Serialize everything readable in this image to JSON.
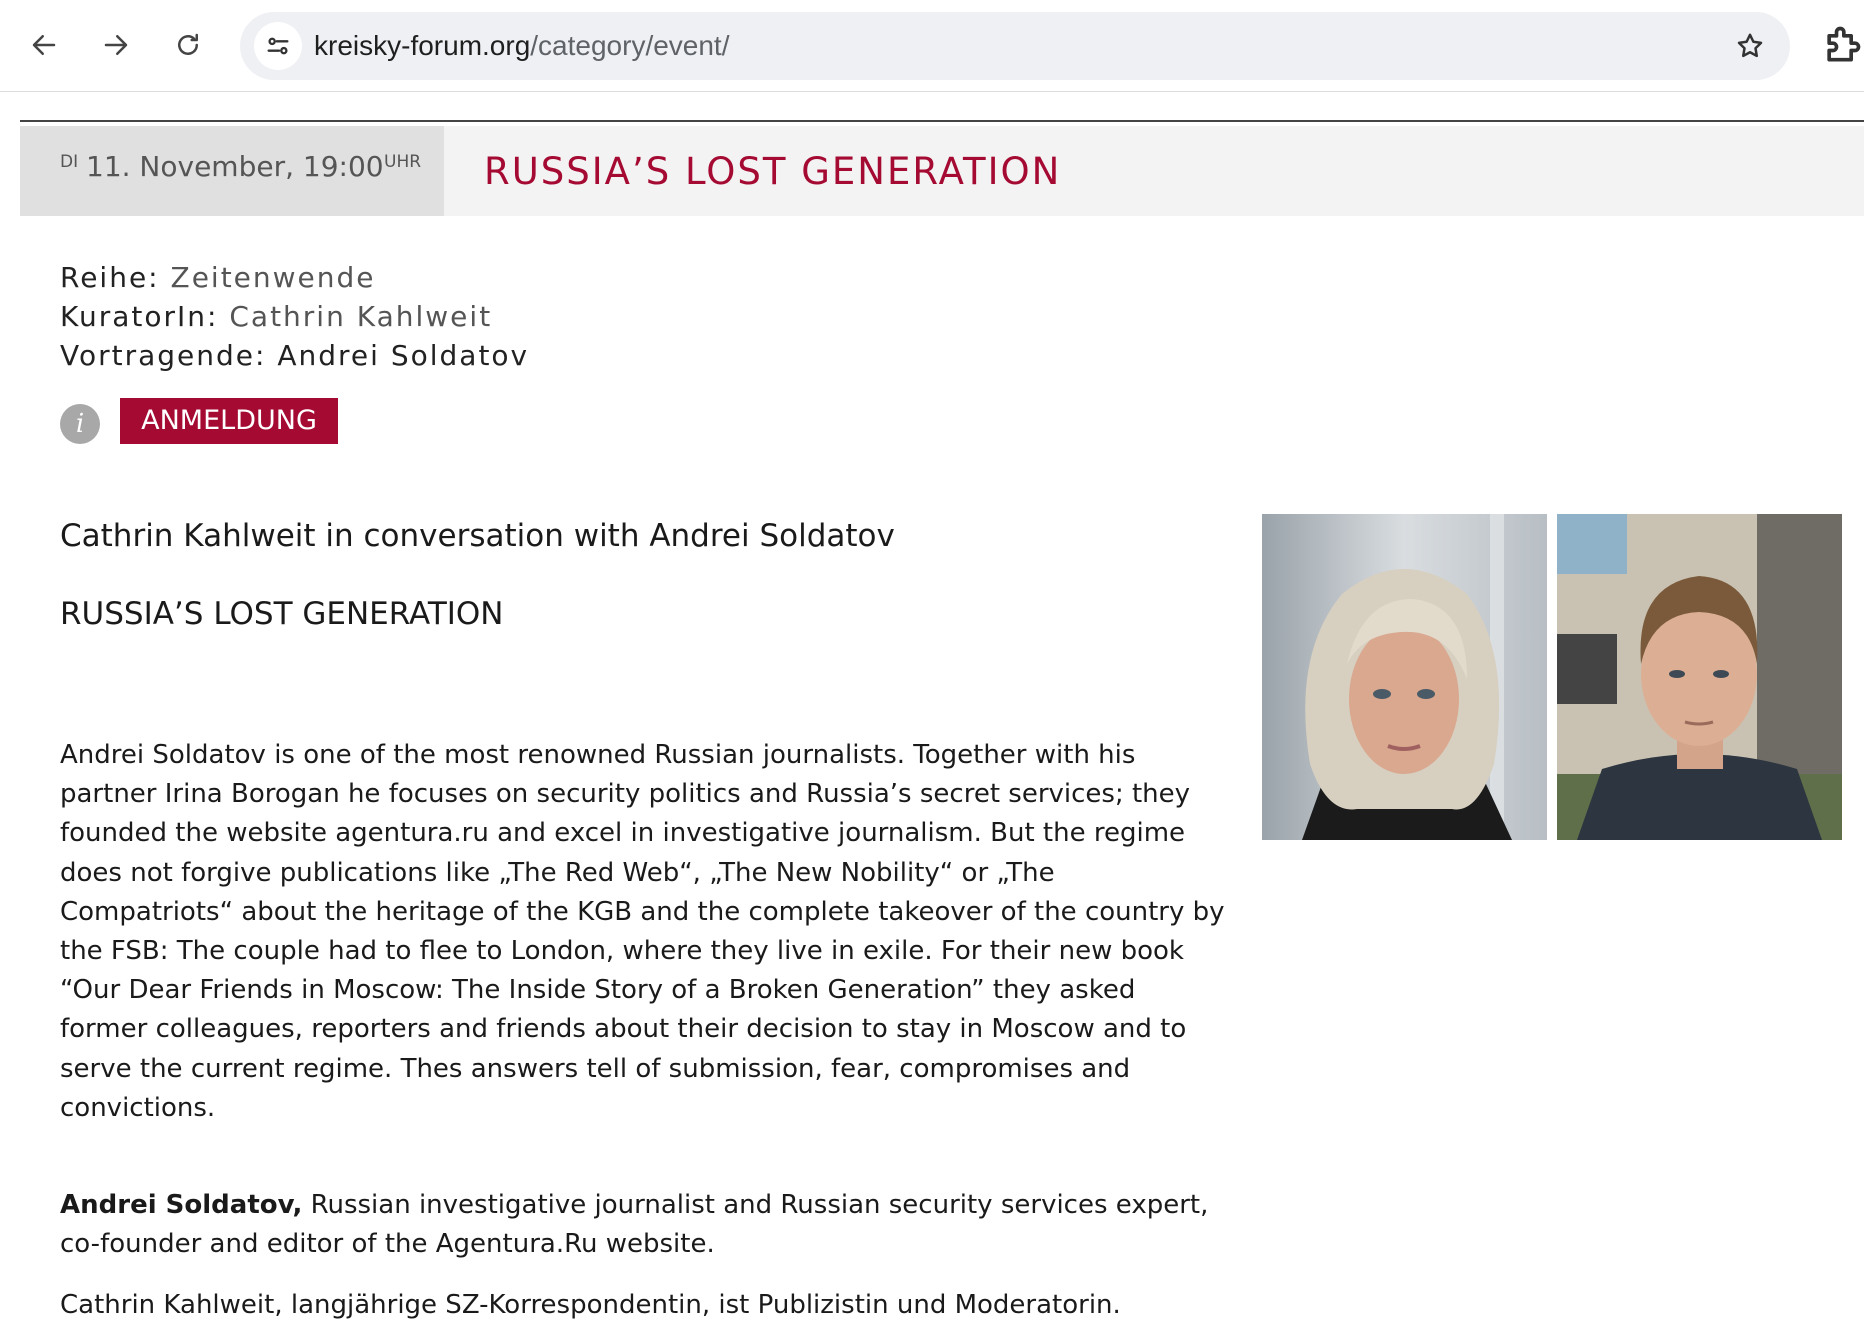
{
  "browser": {
    "url_host": "kreisky-forum.org",
    "url_path": "/category/event/",
    "icons": [
      "back-arrow-icon",
      "forward-arrow-icon",
      "reload-icon",
      "site-info-icon",
      "bookmark-star-icon",
      "extensions-icon"
    ]
  },
  "event": {
    "day": "DI",
    "date": "11. November, 19:00",
    "time_unit": "UHR",
    "title": "RUSSIA’S LOST GENERATION",
    "reihe_label": "Reihe:",
    "reihe_value": "Zeitenwende",
    "kurator_label": "KuratorIn:",
    "kurator_value": "Cathrin Kahlweit",
    "vortragende_label": "Vortragende:",
    "vortragende_value": "Andrei Soldatov",
    "info_glyph": "i",
    "register_label": "ANMELDUNG"
  },
  "content": {
    "subtitle": "Cathrin Kahlweit in conversation with Andrei Soldatov",
    "headline": "RUSSIA’S LOST GENERATION",
    "body": "Andrei Soldatov is one of the most renowned Russian journalists. Together with his partner Irina Borogan he focuses on security politics and Russia’s secret services; they founded the website agentura.ru and excel in investigative journalism.  But the regime does not forgive publications like „The Red Web“, „The New Nobility“ or „The Compatriots“ about the heritage of the KGB and the complete takeover of the country by the FSB: The couple had to flee to London, where they live in exile. For their new book “Our Dear Friends in Moscow: The Inside Story of a Broken Generation” they asked former colleagues, reporters and friends about their decision to stay in Moscow and to serve the current regime. Thes answers tell of submission, fear, compromises and convictions.",
    "bio1_name": "Andrei Soldatov,",
    "bio1_text": " Russian investigative journalist and Russian security services expert, co-founder and editor of the Agentura.Ru website.",
    "bio2_name": "Cathrin Kahlweit",
    "bio2_text": ", langjährige SZ-Korrespondentin, ist Publizistin und Moderatorin."
  },
  "colors": {
    "brand": "#a50a32",
    "date_box": "#e0e0e0",
    "title_bar": "#f3f3f3"
  }
}
